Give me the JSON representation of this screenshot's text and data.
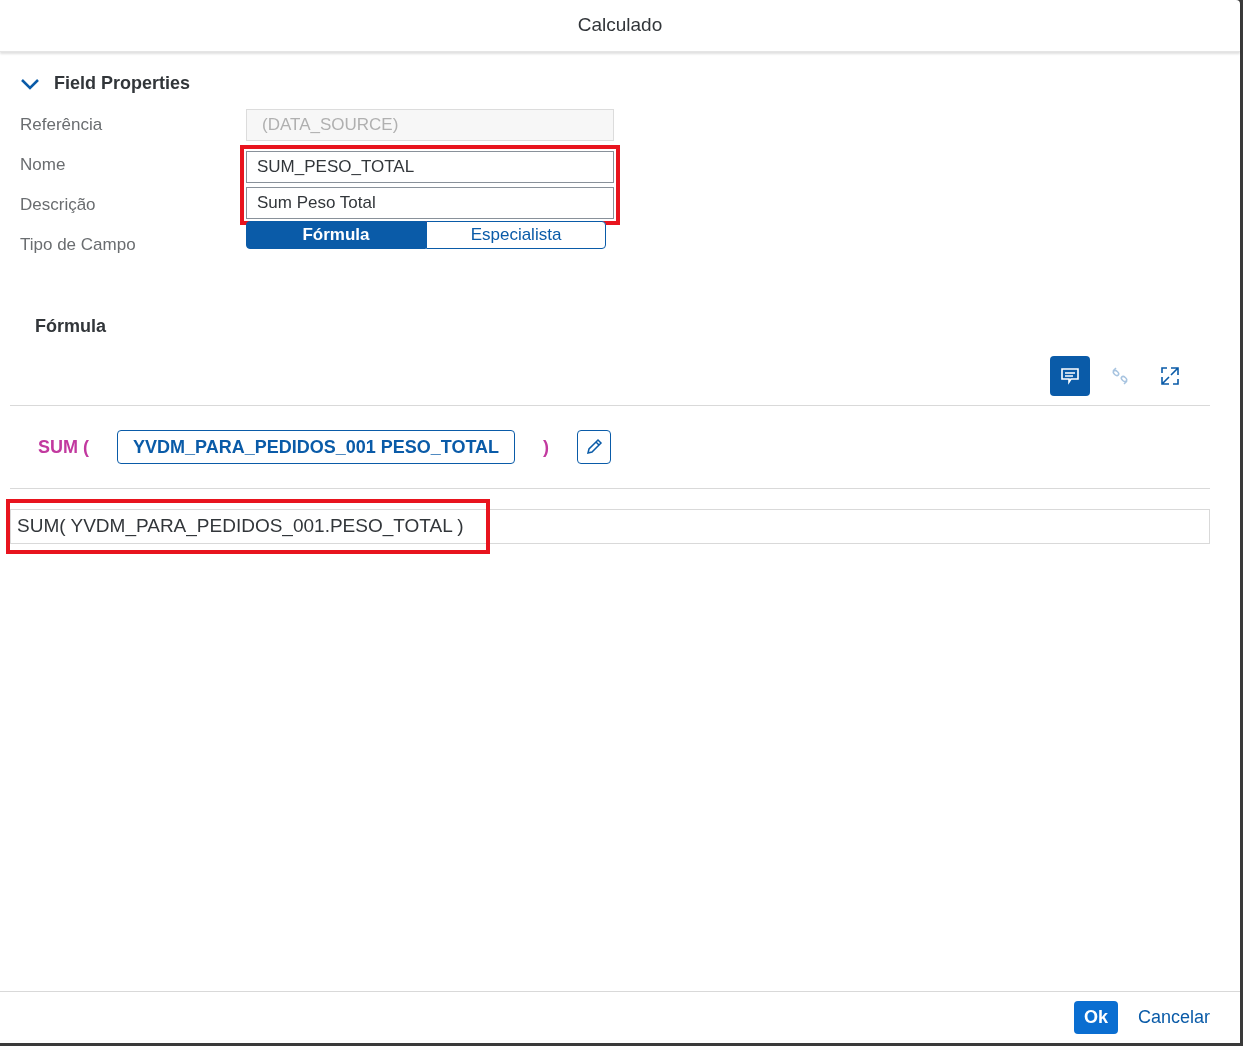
{
  "dialog": {
    "title": "Calculado"
  },
  "section": {
    "title": "Field Properties",
    "expanded": true
  },
  "fields": [
    {
      "label": "Referência",
      "value": "(DATA_SOURCE)",
      "disabled": true,
      "highlighted": false
    },
    {
      "label": "Nome",
      "value": "SUM_PESO_TOTAL",
      "disabled": false,
      "highlighted": true
    },
    {
      "label": "Descrição",
      "value": "Sum Peso Total",
      "disabled": false,
      "highlighted": true
    }
  ],
  "field_type": {
    "label": "Tipo de Campo",
    "options": [
      {
        "label": "Fórmula",
        "selected": true
      },
      {
        "label": "Especialista",
        "selected": false
      }
    ]
  },
  "formula": {
    "title": "Fórmula",
    "toolbar": [
      {
        "kind": "comment",
        "selected": true,
        "disabled": false
      },
      {
        "kind": "unlink",
        "selected": false,
        "disabled": true
      },
      {
        "kind": "expand",
        "selected": false,
        "disabled": false
      }
    ],
    "tokens": [
      {
        "kind": "function",
        "text": "SUM ("
      },
      {
        "kind": "field",
        "text": "YVDM_PARA_PEDIDOS_001 PESO_TOTAL"
      },
      {
        "kind": "function",
        "text": ")"
      },
      {
        "kind": "edit"
      }
    ],
    "expression": "SUM( YVDM_PARA_PEDIDOS_001.PESO_TOTAL )",
    "expression_highlighted": true
  },
  "footer": {
    "buttons": [
      {
        "label": "Ok",
        "kind": "primary"
      },
      {
        "label": "Cancelar",
        "kind": "link"
      }
    ]
  }
}
